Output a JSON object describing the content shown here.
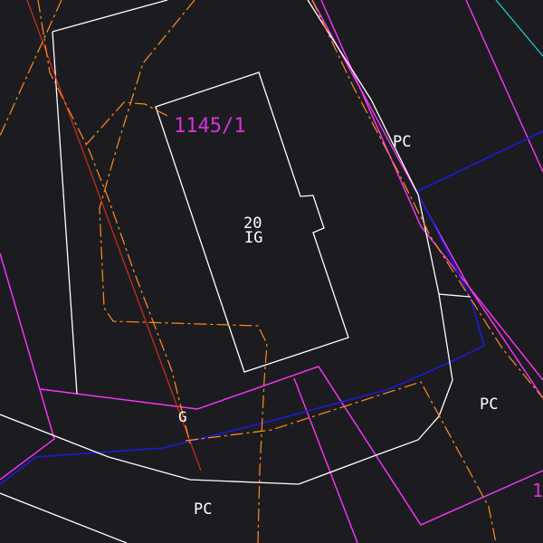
{
  "map": {
    "background": "#1c1c20",
    "colors": {
      "building_outline": "#ffffff",
      "parcel_outline": "#ff33ff",
      "orange_dashed": "#ff8c1a",
      "blue_line": "#1a1adc",
      "cyan_line": "#22d3d3",
      "red_line": "#d42a1a",
      "label_white": "#ffffff",
      "label_magenta": "#d633d6"
    },
    "labels": {
      "parcel_number": "1145/1",
      "building_number": "20",
      "building_code": "IG",
      "pc_top_right": "PC",
      "pc_right": "PC",
      "pc_bottom": "PC",
      "g_label": "G",
      "partial_right": "1"
    }
  }
}
